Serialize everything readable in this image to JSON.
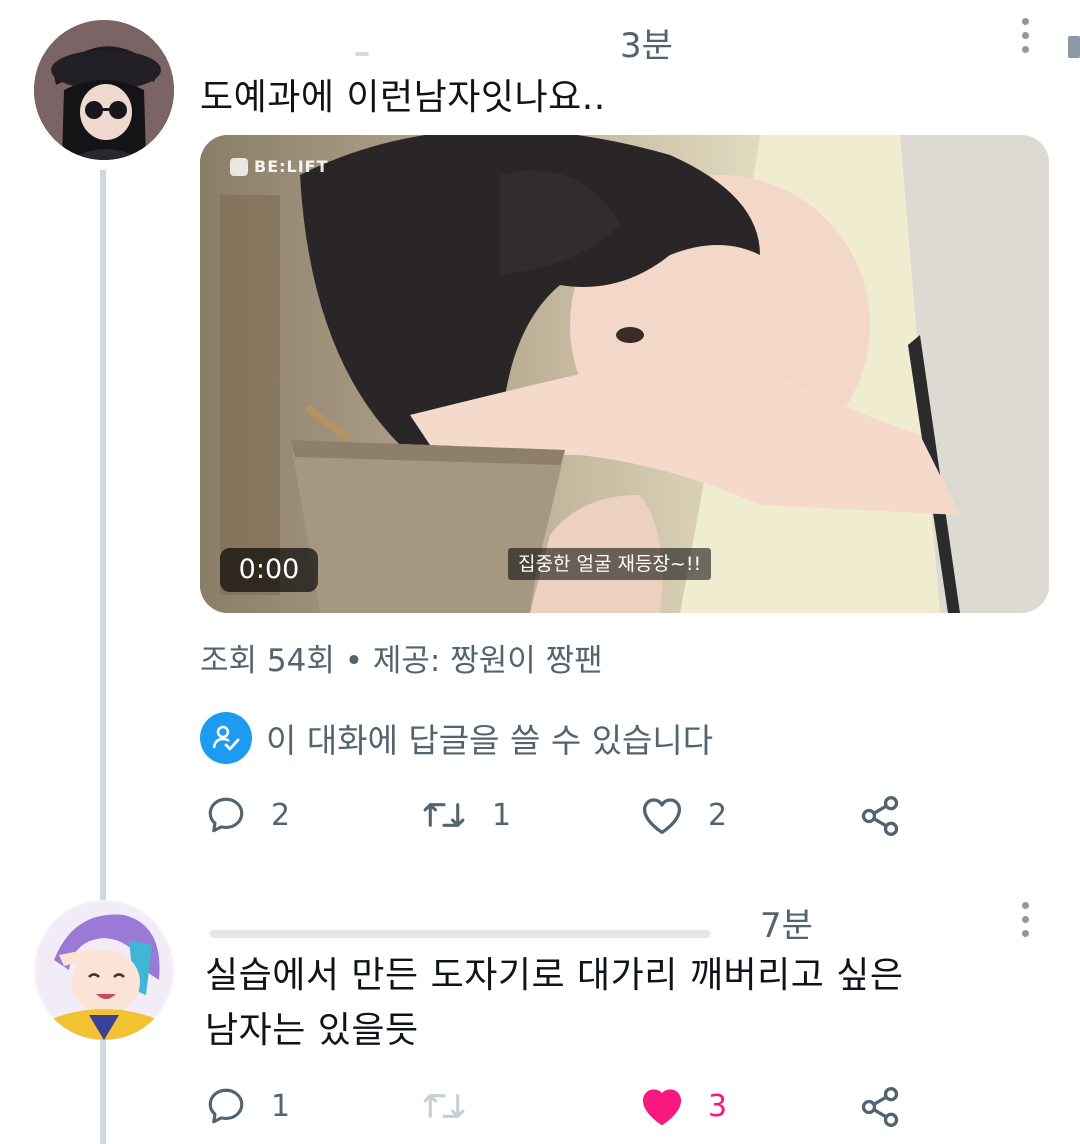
{
  "tweet": {
    "time": "3분",
    "text": "도예과에 이런남자잇나요..",
    "video": {
      "brand": "BE:LIFT",
      "duration": "0:00",
      "subtitle": "집중한 얼굴 재등장~!!"
    },
    "meta": "조회 54회 • 제공: 짱원이 짱팬",
    "reply_permission": "이 대화에 답글을 쓸 수 있습니다",
    "actions": {
      "reply_count": "2",
      "retweet_count": "1",
      "like_count": "2"
    }
  },
  "reply": {
    "time": "7분",
    "text_line1": "실습에서 만든 도자기로 대가리 깨버리고 싶은",
    "text_line2": "남자는 있을듯",
    "actions": {
      "reply_count": "1",
      "like_count": "3"
    }
  },
  "colors": {
    "muted": "#536471",
    "accent_blue": "#1d9bf0",
    "like_pink": "#f91880",
    "thread_line": "#cfd9de"
  },
  "icons": [
    "reply-icon",
    "retweet-icon",
    "like-icon",
    "share-icon",
    "more-icon",
    "reply-permission-icon"
  ]
}
